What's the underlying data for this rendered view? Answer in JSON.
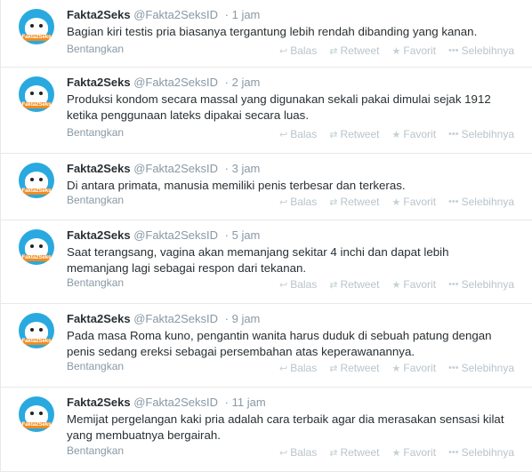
{
  "actions": {
    "reply": "Balas",
    "retweet": "Retweet",
    "favorite": "Favorit",
    "more": "Selebihnya",
    "expand": "Bentangkan"
  },
  "avatar_badge": "Fakta2Seks",
  "tweets": [
    {
      "name": "Fakta2Seks",
      "handle": "@Fakta2SeksID",
      "time": "· 1 jam",
      "text": "Bagian kiri testis pria biasanya tergantung lebih rendah dibanding yang kanan."
    },
    {
      "name": "Fakta2Seks",
      "handle": "@Fakta2SeksID",
      "time": "· 2 jam",
      "text": "Produksi kondom secara massal yang digunakan sekali pakai dimulai sejak 1912 ketika penggunaan lateks dipakai secara luas."
    },
    {
      "name": "Fakta2Seks",
      "handle": "@Fakta2SeksID",
      "time": "· 3 jam",
      "text": "Di antara primata, manusia memiliki penis terbesar dan terkeras."
    },
    {
      "name": "Fakta2Seks",
      "handle": "@Fakta2SeksID",
      "time": "· 5 jam",
      "text": "Saat terangsang, vagina akan memanjang sekitar 4 inchi dan dapat lebih memanjang lagi sebagai respon dari tekanan."
    },
    {
      "name": "Fakta2Seks",
      "handle": "@Fakta2SeksID",
      "time": "· 9 jam",
      "text": "Pada masa Roma kuno, pengantin wanita harus duduk di sebuah patung dengan penis sedang ereksi sebagai persembahan atas keperawanannya."
    },
    {
      "name": "Fakta2Seks",
      "handle": "@Fakta2SeksID",
      "time": "· 11 jam",
      "text": "Memijat pergelangan kaki pria adalah cara terbaik agar dia merasakan sensasi kilat yang membuatnya bergairah."
    }
  ]
}
